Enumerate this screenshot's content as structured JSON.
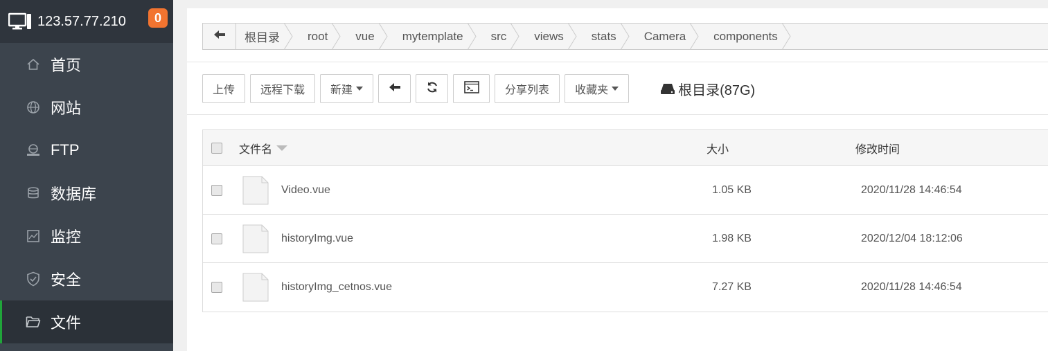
{
  "header": {
    "ip": "123.57.77.210",
    "badge": "0"
  },
  "sidebar": {
    "items": [
      {
        "label": "首页",
        "icon": "home-icon"
      },
      {
        "label": "网站",
        "icon": "globe-icon"
      },
      {
        "label": "FTP",
        "icon": "ftp-icon"
      },
      {
        "label": "数据库",
        "icon": "database-icon"
      },
      {
        "label": "监控",
        "icon": "monitor-icon"
      },
      {
        "label": "安全",
        "icon": "shield-icon"
      },
      {
        "label": "文件",
        "icon": "folder-icon"
      }
    ]
  },
  "breadcrumb": [
    "根目录",
    "root",
    "vue",
    "mytemplate",
    "src",
    "views",
    "stats",
    "Camera",
    "components"
  ],
  "toolbar": {
    "upload": "上传",
    "remote_download": "远程下载",
    "new": "新建",
    "share_list": "分享列表",
    "favorites": "收藏夹",
    "disk_label": "根目录(87G)"
  },
  "table": {
    "headers": {
      "name": "文件名",
      "size": "大小",
      "time": "修改时间"
    },
    "rows": [
      {
        "name": "Video.vue",
        "size": "1.05 KB",
        "time": "2020/11/28 14:46:54"
      },
      {
        "name": "historyImg.vue",
        "size": "1.98 KB",
        "time": "2020/12/04 18:12:06"
      },
      {
        "name": "historyImg_cetnos.vue",
        "size": "7.27 KB",
        "time": "2020/11/28 14:46:54"
      }
    ]
  },
  "colors": {
    "accent": "#20a53a",
    "badge": "#f27430",
    "sidebar": "#3c444d"
  }
}
